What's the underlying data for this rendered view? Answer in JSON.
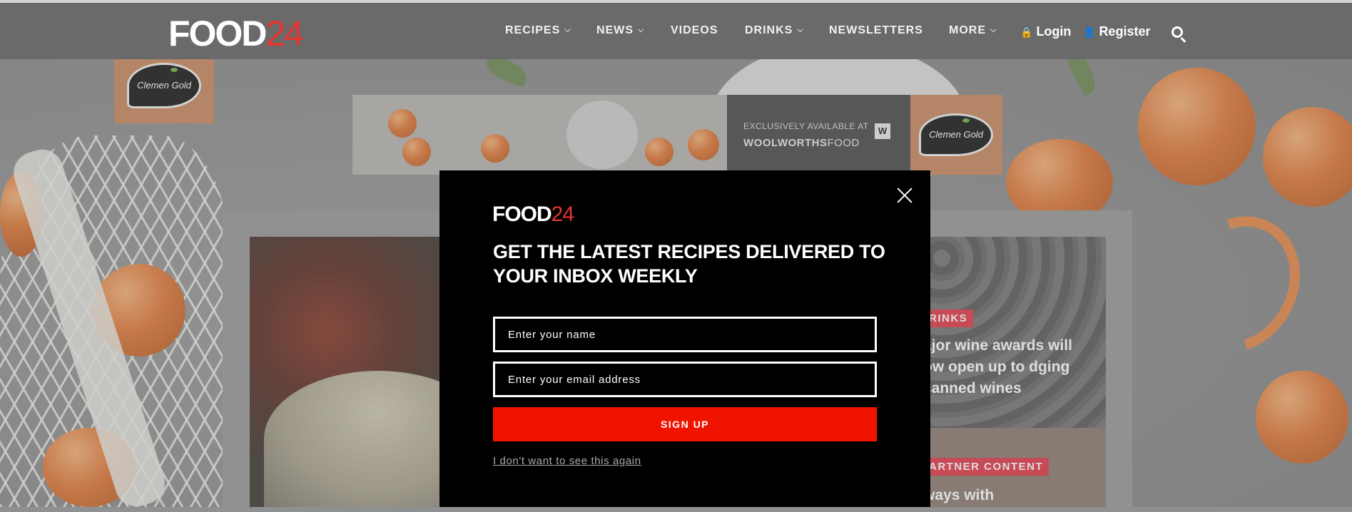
{
  "header": {
    "logo_a": "FOOD",
    "logo_b": "24",
    "nav": [
      {
        "label": "RECIPES",
        "chev": "⌵"
      },
      {
        "label": "NEWS",
        "chev": "⌵"
      },
      {
        "label": "VIDEOS",
        "chev": ""
      },
      {
        "label": "DRINKS",
        "chev": "⌵"
      },
      {
        "label": "NEWSLETTERS",
        "chev": ""
      },
      {
        "label": "MORE",
        "chev": "⌵"
      }
    ],
    "login": "Login",
    "register": "Register"
  },
  "ad": {
    "brand": "Clemen Gold",
    "exclusive": "EXCLUSIVELY AVAILABLE AT",
    "store_bold": "WOOLWORTHS",
    "store_light": "FOOD",
    "store_badge": "W"
  },
  "articles": [
    {
      "tag": "RINKS",
      "title": "ajor wine awards will ow open up to dging canned wines"
    },
    {
      "tag": "ARTNER CONTENT",
      "title": "ways with"
    }
  ],
  "modal": {
    "logo_a": "FOOD",
    "logo_b": "24",
    "heading": "GET THE LATEST RECIPES DELIVERED TO YOUR INBOX WEEKLY",
    "name_placeholder": "Enter your name",
    "email_placeholder": "Enter your email address",
    "signup": "SIGN UP",
    "dismiss": "I don't want to see this again"
  },
  "icons": {
    "lock": "lock-icon",
    "user": "user-icon",
    "search": "search-icon",
    "close": "close-icon"
  }
}
